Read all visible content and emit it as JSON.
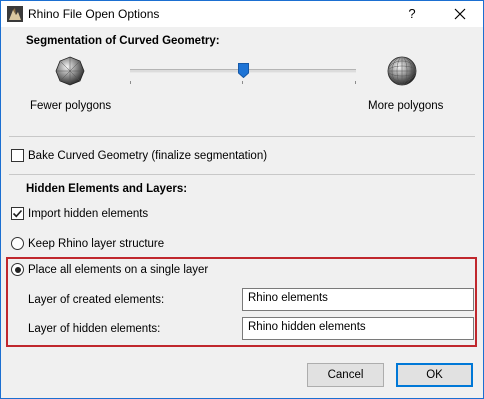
{
  "window": {
    "title": "Rhino File Open Options",
    "help_glyph": "?"
  },
  "segmentation": {
    "heading": "Segmentation of Curved Geometry:",
    "fewer_label": "Fewer polygons",
    "more_label": "More polygons",
    "slider_level": 0.5
  },
  "bake": {
    "label": "Bake Curved Geometry (finalize segmentation)",
    "checked": false
  },
  "hidden": {
    "heading": "Hidden Elements and Layers:",
    "import_label": "Import hidden elements",
    "import_checked": true,
    "keep_label": "Keep Rhino layer structure",
    "keep_selected": false,
    "single_label": "Place all elements on a single layer",
    "single_selected": true,
    "created_label": "Layer of created elements:",
    "created_value": "Rhino elements",
    "hidden_label": "Layer of hidden elements:",
    "hidden_value": "Rhino hidden elements"
  },
  "buttons": {
    "cancel": "Cancel",
    "ok": "OK"
  },
  "colors": {
    "window_border": "#1b6fd1",
    "highlight_box": "#c0272d",
    "slider_thumb": "#1e74d6",
    "default_button_border": "#0078d7"
  },
  "icons": {
    "app": "rhino-icon",
    "close": "close-icon",
    "sphere_low": "low-poly-sphere-icon",
    "sphere_high": "high-poly-sphere-icon",
    "check": "checkmark-icon"
  }
}
